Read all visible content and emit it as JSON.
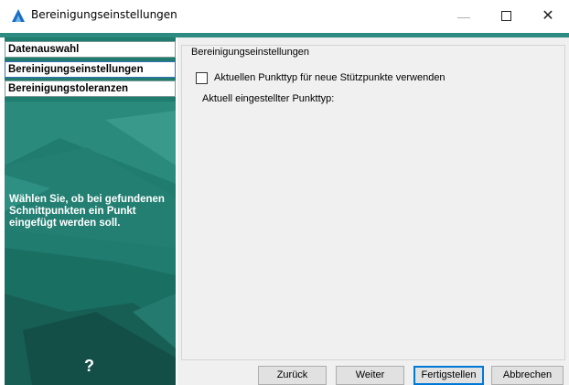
{
  "window": {
    "title": "Bereinigungseinstellungen",
    "minimize_glyph": "—",
    "close_glyph": "✕"
  },
  "sidebar": {
    "items": [
      {
        "label": "Datenauswahl",
        "active": false
      },
      {
        "label": "Bereinigungseinstellungen",
        "active": true
      },
      {
        "label": "Bereinigungstoleranzen",
        "active": false
      }
    ],
    "description": "Wählen Sie, ob bei gefundenen Schnittpunkten ein Punkt eingefügt werden soll.",
    "help_glyph": "?"
  },
  "main": {
    "group_title": "Bereinigungseinstellungen",
    "checkbox_label": "Aktuellen Punkttyp für neue Stützpunkte verwenden",
    "checkbox_checked": false,
    "current_type_label": "Aktuell eingestellter Punkttyp:"
  },
  "buttons": {
    "back": "Zurück",
    "next": "Weiter",
    "finish": "Fertigstellen",
    "cancel": "Abbrechen"
  },
  "colors": {
    "accent": "#2e8b82",
    "sidebar_bg": "#1f7c6f",
    "app_icon_blue": "#1a6fc4"
  },
  "icons": {
    "app": "autocad-a-icon",
    "help": "question-mark-icon"
  }
}
